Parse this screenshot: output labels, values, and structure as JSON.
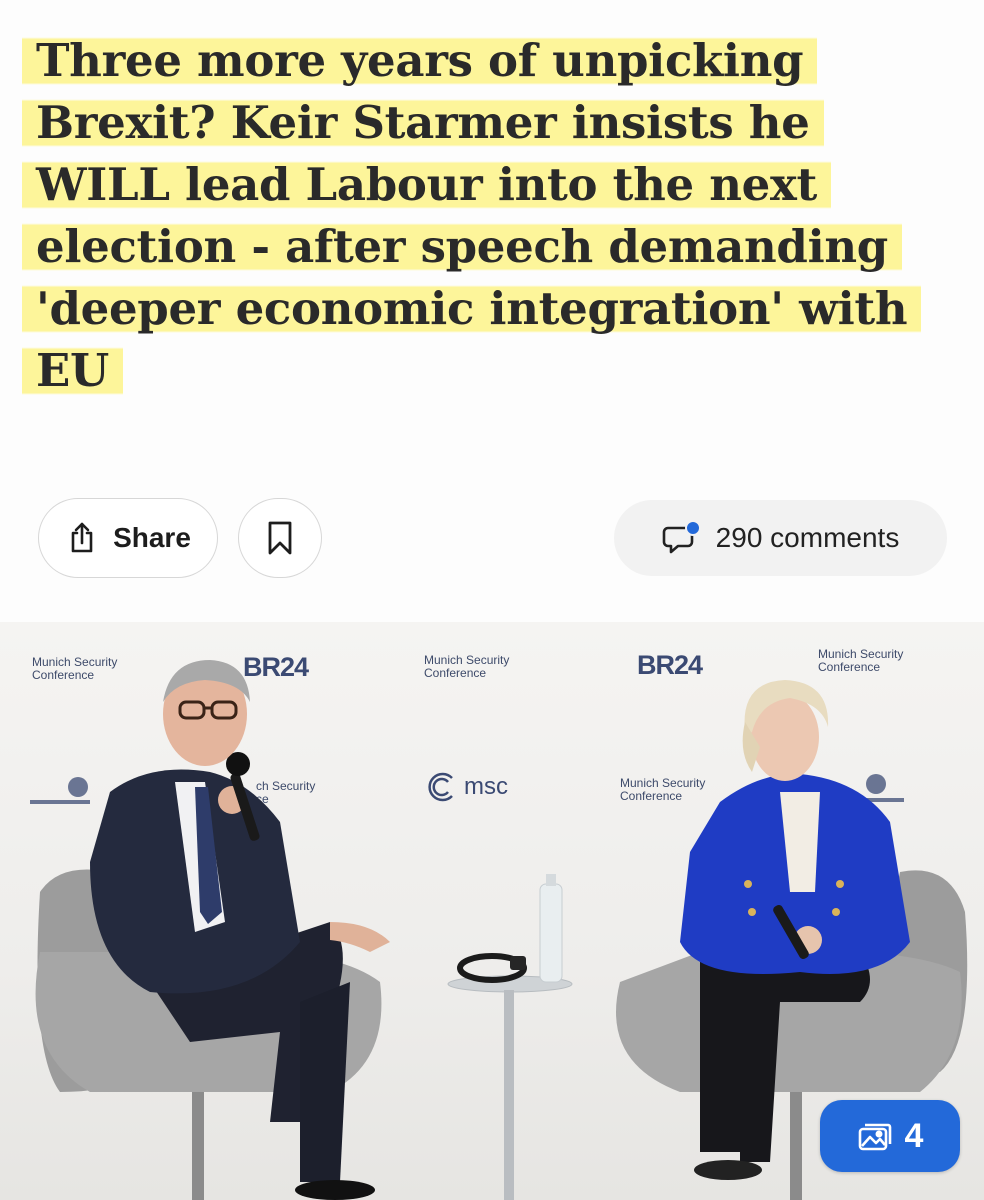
{
  "article": {
    "headline": "Three more years of unpicking Brexit? Keir Starmer insists he WILL lead Labour into the next election - after speech demanding 'deeper economic integration' with EU"
  },
  "actions": {
    "share_label": "Share",
    "comments_label": "290 comments"
  },
  "photo": {
    "backdrop_texts": {
      "msc_line1": "Munich Security",
      "msc_line2": "Conference",
      "br24": "BR24",
      "msc_logo": "msc",
      "partial_left": "ch Security",
      "partial_left2": "ce"
    },
    "gallery_count": "4"
  },
  "colors": {
    "highlight": "#fdf59a",
    "accent": "#2369d9",
    "jacket_blue": "#1f3cc4"
  }
}
